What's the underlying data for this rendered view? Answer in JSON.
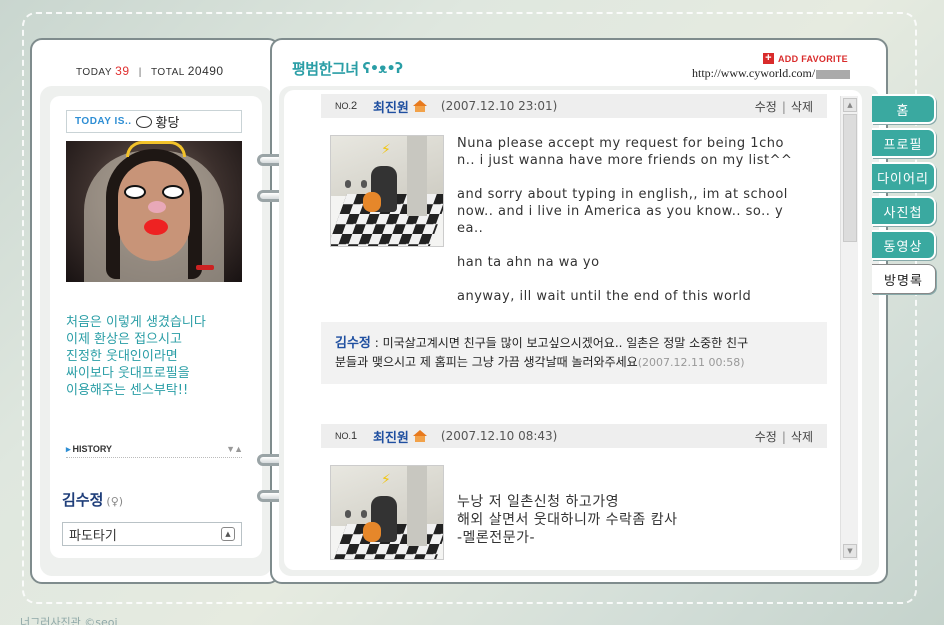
{
  "counter": {
    "today_label": "TODAY",
    "today_value": "39",
    "total_label": "TOTAL",
    "total_value": "20490"
  },
  "profile": {
    "today_is_label": "TODAY IS..",
    "mood": "황당",
    "intro_lines": [
      "처음은 이렇게 생겼습니다",
      "이제 환상은 접으시고",
      "진정한 웃대인이라면",
      "싸이보다 웃대프로필을",
      "이용해주는 센스부탁!!"
    ],
    "history_label": "HISTORY",
    "owner_name": "김수정",
    "owner_gender": "(♀)",
    "select_value": "파도타기"
  },
  "header": {
    "site_title": "평범한그녀",
    "add_favorite": "ADD FAVORITE",
    "url": "http://www.cyworld.com/"
  },
  "tabs": [
    "홈",
    "프로필",
    "다이어리",
    "사진첩",
    "동영상",
    "방명록"
  ],
  "guestbook": [
    {
      "no_label": "NO.",
      "no": "2",
      "name": "최진원",
      "date": "(2007.12.10 23:01)",
      "edit": "수정",
      "delete": "삭제",
      "message_lines": [
        "Nuna please accept my request for being 1cho",
        "n.. i just wanna have more friends on my list^^",
        "",
        "and sorry about typing in english,, im at school",
        "now.. and i live in America as you know.. so.. y",
        "ea..",
        "",
        "han ta ahn na wa yo",
        "",
        "anyway, ill wait until the end of this world"
      ],
      "reply": {
        "name": "김수정",
        "text_line1": ": 미국살고계시면 친구들 많이 보고싶으시겠어요.. 일촌은 정말 소중한 친구",
        "text_line2": "분들과 맺으시고 제 홈피는 그냥 가끔 생각날때 놀러와주세요",
        "time": "(2007.12.11 00:58)"
      }
    },
    {
      "no_label": "NO.",
      "no": "1",
      "name": "최진원",
      "date": "(2007.12.10 08:43)",
      "edit": "수정",
      "delete": "삭제",
      "message_lines": [
        "누낭 저 일촌신청 하고가영",
        "해외 살면서 웃대하니까 수락좀 캄사",
        "-멜론전문가-"
      ]
    }
  ],
  "footer": {
    "text": "너그러사진관 ©seoj"
  },
  "colors": {
    "accent_teal": "#3aa9a0",
    "title_teal": "#2a9ea6",
    "name_blue": "#1f4fa0",
    "fav_red": "#d92b2b",
    "today_red": "#e03030"
  }
}
